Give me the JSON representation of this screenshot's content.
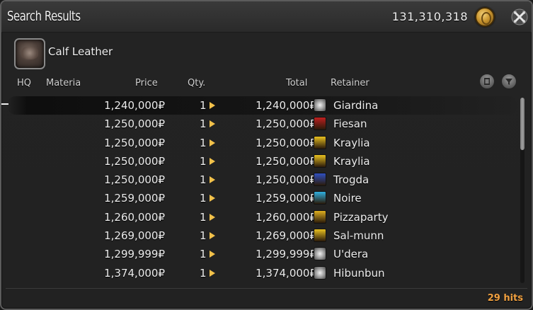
{
  "window": {
    "title": "Search Results"
  },
  "gil": {
    "amount": "131,310,318",
    "icon": "gil-coin-icon"
  },
  "item": {
    "name": "Calf Leather",
    "icon": "calf-leather-icon"
  },
  "columns": {
    "hq": "HQ",
    "materia": "Materia",
    "price": "Price",
    "qty": "Qty.",
    "total": "Total",
    "retainer": "Retainer"
  },
  "listings": [
    {
      "price": "1,240,000₽",
      "qty": "1",
      "total": "1,240,000₽",
      "retainer": "Giardina",
      "city_icon": "spiral-icon",
      "city_color": "#d8d8d8"
    },
    {
      "price": "1,250,000₽",
      "qty": "1",
      "total": "1,250,000₽",
      "retainer": "Fiesan",
      "city_icon": "red-crest-icon",
      "city_color": "#c02020"
    },
    {
      "price": "1,250,000₽",
      "qty": "1",
      "total": "1,250,000₽",
      "retainer": "Kraylia",
      "city_icon": "yellow-crest-icon",
      "city_color": "#e8c020"
    },
    {
      "price": "1,250,000₽",
      "qty": "1",
      "total": "1,250,000₽",
      "retainer": "Kraylia",
      "city_icon": "yellow-crest-icon",
      "city_color": "#e8c020"
    },
    {
      "price": "1,250,000₽",
      "qty": "1",
      "total": "1,250,000₽",
      "retainer": "Trogda",
      "city_icon": "blue-crest-icon",
      "city_color": "#3050c0"
    },
    {
      "price": "1,259,000₽",
      "qty": "1",
      "total": "1,259,000₽",
      "retainer": "Noire",
      "city_icon": "cyan-crest-icon",
      "city_color": "#30b0e0"
    },
    {
      "price": "1,260,000₽",
      "qty": "1",
      "total": "1,260,000₽",
      "retainer": "Pizzaparty",
      "city_icon": "yellow-crest-icon",
      "city_color": "#e0b020"
    },
    {
      "price": "1,269,000₽",
      "qty": "1",
      "total": "1,269,000₽",
      "retainer": "Sal-munn",
      "city_icon": "yellow-crest-icon",
      "city_color": "#e8c020"
    },
    {
      "price": "1,299,999₽",
      "qty": "1",
      "total": "1,299,999₽",
      "retainer": "U'dera",
      "city_icon": "spiral-icon",
      "city_color": "#d8d8d8"
    },
    {
      "price": "1,374,000₽",
      "qty": "1",
      "total": "1,374,000₽",
      "retainer": "Hibunbun",
      "city_icon": "spiral-icon",
      "city_color": "#d8d8d8"
    }
  ],
  "footer": {
    "hits": "29 hits"
  },
  "colors": {
    "accent": "#f0a040",
    "arrow": "#f2c14a"
  }
}
